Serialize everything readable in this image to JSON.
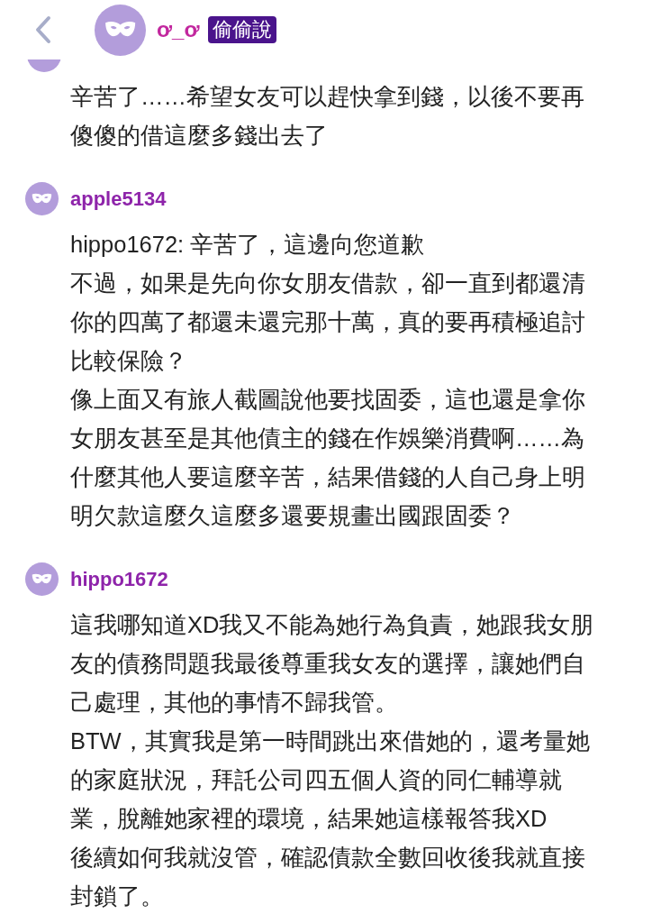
{
  "header": {
    "username": "ơ_ơ",
    "badge": "偷偷說"
  },
  "comments": [
    {
      "kind": "cut_off",
      "lines": [
        "辛苦了……希望女友可以趕快拿到錢，以後不要再",
        "傻傻的借這麼多錢出去了"
      ]
    },
    {
      "kind": "full",
      "author": "apple5134",
      "lines": [
        "hippo1672: 辛苦了，這邊向您道歉",
        "不過，如果是先向你女朋友借款，卻一直到都還清",
        "你的四萬了都還未還完那十萬，真的要再積極追討",
        "比較保險？",
        "像上面又有旅人截圖說他要找固委，這也還是拿你",
        "女朋友甚至是其他債主的錢在作娛樂消費啊……為",
        "什麼其他人要這麼辛苦，結果借錢的人自己身上明",
        "明欠款這麼久這麼多還要規畫出國跟固委？"
      ]
    },
    {
      "kind": "full",
      "author": "hippo1672",
      "lines": [
        "這我哪知道XD我又不能為她行為負責，她跟我女朋",
        "友的債務問題我最後尊重我女友的選擇，讓她們自",
        "己處理，其他的事情不歸我管。",
        "BTW，其實我是第一時間跳出來借她的，還考量她",
        "的家庭狀況，拜託公司四五個人資的同仁輔導就",
        "業，脫離她家裡的環境，結果她這樣報答我XD",
        "後續如何我就沒管，確認債款全數回收後我就直接",
        "封鎖了。"
      ]
    }
  ]
}
